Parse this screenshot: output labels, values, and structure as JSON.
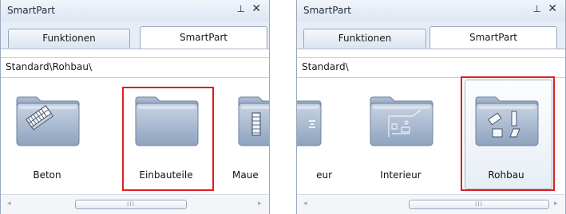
{
  "left_panel": {
    "title": "SmartPart",
    "pin_glyph": "⊥",
    "close_glyph": "✕",
    "tabs": [
      {
        "label": "Funktionen"
      },
      {
        "label": "SmartPart"
      }
    ],
    "path": "Standard\\Rohbau\\",
    "items": [
      {
        "label": "Beton"
      },
      {
        "label": "Einbauteile"
      },
      {
        "label": "Maue"
      }
    ],
    "scroll_grip": "III",
    "arrow_left": "◂",
    "arrow_right": "▸"
  },
  "right_panel": {
    "title": "SmartPart",
    "pin_glyph": "⊥",
    "close_glyph": "✕",
    "tabs": [
      {
        "label": "Funktionen"
      },
      {
        "label": "SmartPart"
      }
    ],
    "path": "Standard\\",
    "items": [
      {
        "label": "eur"
      },
      {
        "label": "Interieur"
      },
      {
        "label": "Rohbau"
      }
    ],
    "scroll_grip": "III",
    "arrow_left": "◂",
    "arrow_right": "▸"
  },
  "colors": {
    "highlight": "#e01e1e",
    "folder": "#8ea3bf"
  }
}
